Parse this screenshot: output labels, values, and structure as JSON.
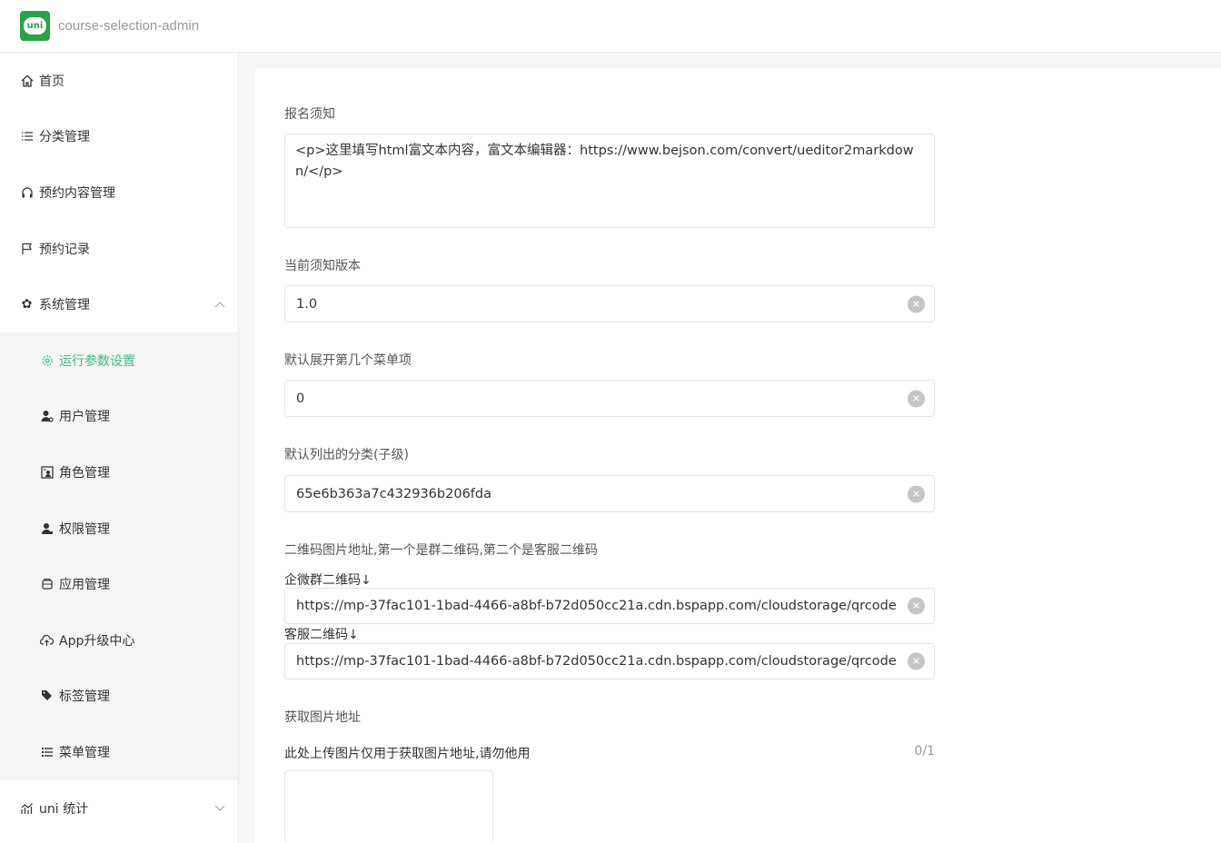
{
  "header": {
    "title": "course-selection-admin",
    "logo_text": "uni"
  },
  "sidebar": {
    "items": [
      {
        "label": "首页",
        "icon": "home-icon"
      },
      {
        "label": "分类管理",
        "icon": "list-icon"
      },
      {
        "label": "预约内容管理",
        "icon": "headphones-icon"
      },
      {
        "label": "预约记录",
        "icon": "flag-icon"
      },
      {
        "label": "系统管理",
        "icon": "gear-icon",
        "expanded": true
      }
    ],
    "submenu": [
      {
        "label": "运行参数设置",
        "icon": "settings-icon",
        "active": true
      },
      {
        "label": "用户管理",
        "icon": "user-icon"
      },
      {
        "label": "角色管理",
        "icon": "role-icon"
      },
      {
        "label": "权限管理",
        "icon": "permission-icon"
      },
      {
        "label": "应用管理",
        "icon": "app-icon"
      },
      {
        "label": "App升级中心",
        "icon": "upload-cloud-icon"
      },
      {
        "label": "标签管理",
        "icon": "tag-icon"
      },
      {
        "label": "菜单管理",
        "icon": "menu-icon"
      }
    ],
    "bottom": {
      "label": "uni 统计",
      "icon": "stats-icon"
    }
  },
  "form": {
    "notice_label": "报名须知",
    "notice_value": "<p>这里填写html富文本内容，富文本编辑器：https://www.bejson.com/convert/ueditor2markdown/</p>",
    "version_label": "当前须知版本",
    "version_value": "1.0",
    "expand_label": "默认展开第几个菜单项",
    "expand_value": "0",
    "category_label": "默认列出的分类(子级)",
    "category_value": "65e6b363a7c432936b206fda",
    "qrcode_label": "二维码图片地址,第一个是群二维码,第二个是客服二维码",
    "qrcode1_label": "企微群二维码↓",
    "qrcode1_value": "https://mp-37fac101-1bad-4466-a8bf-b72d050cc21a.cdn.bspapp.com/cloudstorage/qrcode",
    "qrcode2_label": "客服二维码↓",
    "qrcode2_value": "https://mp-37fac101-1bad-4466-a8bf-b72d050cc21a.cdn.bspapp.com/cloudstorage/qrcode",
    "image_url_label": "获取图片地址",
    "upload_hint": "此处上传图片仅用于获取图片地址,请勿他用",
    "upload_count": "0/1"
  },
  "colors": {
    "accent": "#42b983",
    "logo": "#2ba245"
  }
}
